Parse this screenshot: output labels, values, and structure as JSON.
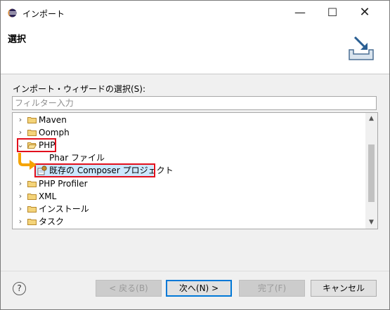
{
  "window": {
    "title": "インポート",
    "minimize_glyph": "—",
    "maximize_glyph": "☐",
    "close_glyph": "✕"
  },
  "header": {
    "title": "選択",
    "graphic_icon": "import-tray-icon"
  },
  "wizard": {
    "select_label": "インポート・ウィザードの選択(S):",
    "filter_placeholder": "フィルター入力",
    "filter_value": ""
  },
  "tree": {
    "items": [
      {
        "label": "Maven",
        "twisty": "›",
        "icon": "folder-icon"
      },
      {
        "label": "Oomph",
        "twisty": "›",
        "icon": "folder-icon"
      },
      {
        "label": "PHP",
        "twisty": "⌄",
        "icon": "folder-open-icon",
        "expanded": true
      },
      {
        "label": "Phar ファイル",
        "icon": "phar-file-icon"
      },
      {
        "label": "既存の Composer プロジェクト",
        "icon": "composer-project-icon",
        "selected": true
      },
      {
        "label": "PHP Profiler",
        "twisty": "›",
        "icon": "folder-icon"
      },
      {
        "label": "XML",
        "twisty": "›",
        "icon": "folder-icon"
      },
      {
        "label": "インストール",
        "twisty": "›",
        "icon": "folder-icon"
      },
      {
        "label": "タスク",
        "twisty": "›",
        "icon": "folder-icon"
      }
    ],
    "scroll_up_glyph": "▲",
    "scroll_down_glyph": "▼"
  },
  "buttons": {
    "help": "?",
    "back": "< 戻る(B)",
    "next": "次へ(N) >",
    "finish": "完了(F)",
    "cancel": "キャンセル"
  },
  "colors": {
    "highlight_red": "#e2101d",
    "arrow_orange": "#f5a300",
    "selection_blue": "#cce8ff",
    "default_button_border": "#0078d7",
    "folder_yellow": "#e8b84a"
  }
}
